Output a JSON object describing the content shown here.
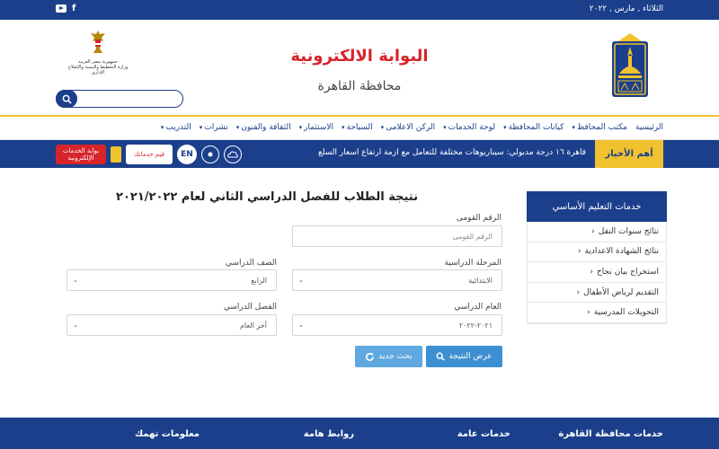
{
  "topbar": {
    "date": "الثلاثاء , مارس , ٢٠٢٢",
    "social": [
      "youtube-icon",
      "facebook-icon"
    ]
  },
  "header": {
    "title": "البوابة الالكترونية",
    "subtitle": "محافظة القاهرة",
    "gov_logo_line1": "جمهورية مصر العربية",
    "gov_logo_line2": "وزارة التخطيط والتنمية والإصلاح الإداري",
    "search_placeholder": ""
  },
  "nav": {
    "items": [
      {
        "label": "الرئيسية",
        "has_caret": false
      },
      {
        "label": "مكتب المحافظ",
        "has_caret": true
      },
      {
        "label": "كيانات المحافظة",
        "has_caret": true
      },
      {
        "label": "لوحة الخدمات",
        "has_caret": true
      },
      {
        "label": "الركن الاعلامى",
        "has_caret": true
      },
      {
        "label": "السياحة",
        "has_caret": true
      },
      {
        "label": "الاستثمار",
        "has_caret": true
      },
      {
        "label": "الثقافة والفنون",
        "has_caret": true
      },
      {
        "label": "نشرات",
        "has_caret": true
      },
      {
        "label": "التدريب",
        "has_caret": true
      }
    ]
  },
  "news": {
    "label": "أهم الأخبار",
    "ticker": "قاهرة ١٦ درجة        مدبولي: سيناريوهات مختلفة للتعامل مع أزمة ارتفاع أسعار السلع",
    "services_button": "بوابة الخدمات الإلكترونية",
    "rate_button": "قيم خدماتك",
    "en_button": "EN"
  },
  "sidebar": {
    "title": "خدمات التعليم الأساسي",
    "items": [
      "نتائج سنوات النقل",
      "نتائج الشهادة الاعدادية",
      "استخراج بيان نجاح",
      "التقديم لرياض الأطفال",
      "التحويلات المدرسية"
    ]
  },
  "form": {
    "title": "نتيجة الطلاب للفصل الدراسي الثاني لعام ٢٠٢١/٢٠٢٢",
    "national_id_label": "الرقم القومى",
    "national_id_placeholder": "الرقم القومى",
    "stage_label": "المرحلة الدراسية",
    "stage_value": "الابتدائية",
    "grade_label": "الصف الدراسي",
    "grade_value": "الرابع",
    "year_label": "العام الدراسي",
    "year_value": "٢٠٢١-٢٠٢٢",
    "term_label": "الفصل الدراسي",
    "term_value": "أخر العام",
    "show_result_button": "عرض النتيجة",
    "new_search_button": "بحث جديد"
  },
  "footer": {
    "columns": [
      "خدمات محافظة القاهرة",
      "خدمات عامة",
      "روابط هامة",
      "معلومات تهمك"
    ]
  },
  "colors": {
    "primary": "#1b3f8b",
    "accent": "#f0c22e",
    "title_red": "#d6242a",
    "button_blue": "#3d8fd1"
  }
}
